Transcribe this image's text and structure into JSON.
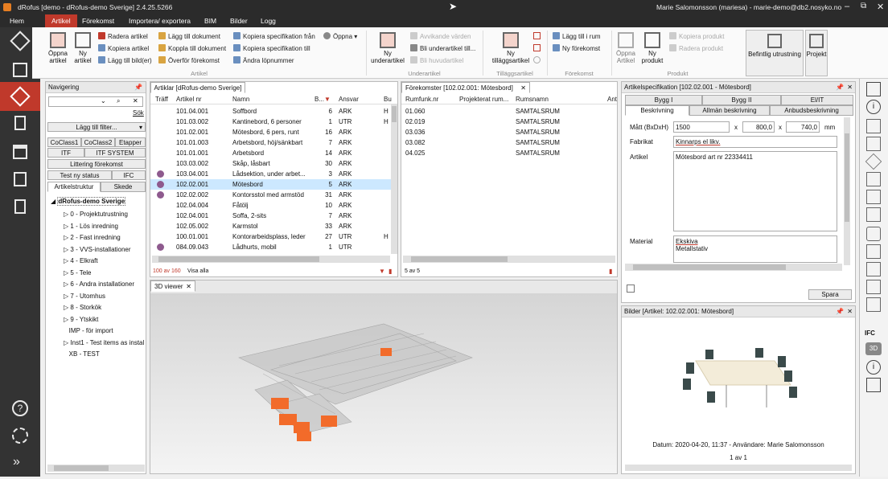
{
  "window": {
    "title": "dRofus [demo - dRofus-demo Sverige] 2.4.25.5266",
    "user": "Marie Salomonsson (mariesa) - marie-demo@db2.nosyko.no"
  },
  "menu": [
    "Hem",
    "Artikel",
    "Förekomst",
    "Importera/ exportera",
    "BIM",
    "Bilder",
    "Logg"
  ],
  "ribbon": {
    "artikel": {
      "big": [
        "Öppna artikel",
        "Ny artikel"
      ],
      "col1": [
        "Radera artikel",
        "Kopiera artikel",
        "Lägg till bild(er)"
      ],
      "col2": [
        "Lägg till dokument",
        "Koppla till dokument",
        "Överför förekomst"
      ],
      "col3": [
        "Kopiera specifikation från",
        "Kopiera specifikation till",
        "Ändra löpnummer"
      ],
      "open": "Öppna",
      "label": "Artikel"
    },
    "underartikel": {
      "big": "Ny underartikel",
      "items": [
        "Avvikande värden",
        "Bli underartikel till...",
        "Bli huvudartikel"
      ],
      "label": "Underartikel"
    },
    "tillagg": {
      "big": "Ny tilläggsartikel",
      "label": "Tilläggsartikel"
    },
    "forekomst": {
      "items": [
        "Lägg till i rum",
        "Ny förekomst"
      ],
      "label": "Förekomst"
    },
    "produkt": {
      "big": [
        "Öppna Artikel",
        "Ny produkt"
      ],
      "items": [
        "Kopiera produkt",
        "Radera produkt"
      ],
      "label": "Produkt"
    },
    "extra": [
      "Befintlig utrustning",
      "Projekt"
    ]
  },
  "nav": {
    "title": "Navigering",
    "search_link": "Sök",
    "filter_btn": "Lägg till filter...",
    "buttons": [
      "CoClass1",
      "CoClass2",
      "Etapper",
      "ITF",
      "ITF SYSTEM",
      "Littering förekomst",
      "Test ny status",
      "IFC"
    ],
    "tabs": [
      "Artikelstruktur",
      "Skede"
    ],
    "root": "dRofus-demo Sverige",
    "tree": [
      "0 - Projektutrustning",
      "1 - Lös inredning",
      "2 - Fast inredning",
      "3 - VVS-installationer",
      "4 - Elkraft",
      "5 - Tele",
      "6 - Andra installationer",
      "7 - Utomhus",
      "8 - Storkök",
      "9 - Ytskikt",
      "IMP - för import",
      "Inst1 - Test items as instal",
      "XB - TEST"
    ]
  },
  "articles": {
    "title": "Artiklar [dRofus-demo Sverige]",
    "headers": [
      "Träff",
      "Artikel nr",
      "Namn",
      "B...",
      "Ansvar",
      "Bu"
    ],
    "rows": [
      {
        "nr": "101.04.001",
        "name": "Soffbord",
        "b": "6",
        "ansvar": "ARK",
        "bu": "H"
      },
      {
        "nr": "101.03.002",
        "name": "Kantinebord, 6 personer",
        "b": "1",
        "ansvar": "UTR",
        "bu": "H"
      },
      {
        "nr": "101.02.001",
        "name": "Mötesbord, 6 pers, runt",
        "b": "16",
        "ansvar": "ARK",
        "bu": ""
      },
      {
        "nr": "101.01.003",
        "name": "Arbetsbord, höj/sänkbart",
        "b": "7",
        "ansvar": "ARK",
        "bu": ""
      },
      {
        "nr": "101.01.001",
        "name": "Arbetsbord",
        "b": "14",
        "ansvar": "ARK",
        "bu": ""
      },
      {
        "nr": "103.03.002",
        "name": "Skåp, låsbart",
        "b": "30",
        "ansvar": "ARK",
        "bu": ""
      },
      {
        "nr": "103.04.001",
        "name": "Lådsektion, under arbet...",
        "b": "3",
        "ansvar": "ARK",
        "bu": ""
      },
      {
        "nr": "102.02.001",
        "name": "Mötesbord",
        "b": "5",
        "ansvar": "ARK",
        "bu": ""
      },
      {
        "nr": "102.02.002",
        "name": "Kontorsstol med armstöd",
        "b": "31",
        "ansvar": "ARK",
        "bu": ""
      },
      {
        "nr": "102.04.004",
        "name": "Fåtölj",
        "b": "10",
        "ansvar": "ARK",
        "bu": ""
      },
      {
        "nr": "102.04.001",
        "name": "Soffa, 2-sits",
        "b": "7",
        "ansvar": "ARK",
        "bu": ""
      },
      {
        "nr": "102.05.002",
        "name": "Karmstol",
        "b": "33",
        "ansvar": "ARK",
        "bu": ""
      },
      {
        "nr": "100.01.001",
        "name": "Kontorarbeidsplass, leder",
        "b": "27",
        "ansvar": "UTR",
        "bu": "H"
      },
      {
        "nr": "084.09.043",
        "name": "Lådhurts, mobil",
        "b": "1",
        "ansvar": "UTR",
        "bu": ""
      }
    ],
    "count": "100 av 160",
    "show_all": "Visa alla"
  },
  "occurrences": {
    "title": "Förekomster [102.02.001: Mötesbord]",
    "headers": [
      "Rumfunk.nr",
      "Projekterat rum...",
      "Rumsnamn",
      "Ant"
    ],
    "rows": [
      {
        "nr": "01.060",
        "room": "SAMTALSRUM"
      },
      {
        "nr": "02.019",
        "room": "SAMTALSRUM"
      },
      {
        "nr": "03.036",
        "room": "SAMTALSRUM"
      },
      {
        "nr": "03.082",
        "room": "SAMTALSRUM"
      },
      {
        "nr": "04.025",
        "room": "SAMTALSRUM"
      }
    ],
    "count": "5 av 5"
  },
  "spec": {
    "title": "Artikelspecifikation [102.02.001 - Mötesbord]",
    "tabs1": [
      "Bygg I",
      "Bygg II",
      "El/IT"
    ],
    "tabs2": [
      "Beskrivning",
      "Allmän beskrivning",
      "Anbudsbeskrivning"
    ],
    "dim_label": "Mått (BxDxH)",
    "dims": [
      "1500",
      "800,0",
      "740,0"
    ],
    "x": "x",
    "unit": "mm",
    "fabrikat_label": "Fabrikat",
    "fabrikat": "Kinnarps el likv.",
    "artikel_label": "Artikel",
    "artikel": "Mötesbord art nr 22334411",
    "material_label": "Material",
    "material": [
      "Ekskiva",
      "Metallstativ"
    ],
    "save": "Spara"
  },
  "images": {
    "title": "Bilder [Artikel: 102.02.001: Mötesbord]",
    "caption": "Datum: 2020-04-20, 11:37 - Användare: Marie Salomonsson",
    "pager": "1 av 1"
  },
  "viewer": {
    "title": "3D viewer"
  },
  "right_labels": {
    "ifc": "IFC",
    "3d": "3D"
  },
  "colors": {
    "accent": "#c0392b",
    "selected_row": "#cce8ff"
  }
}
